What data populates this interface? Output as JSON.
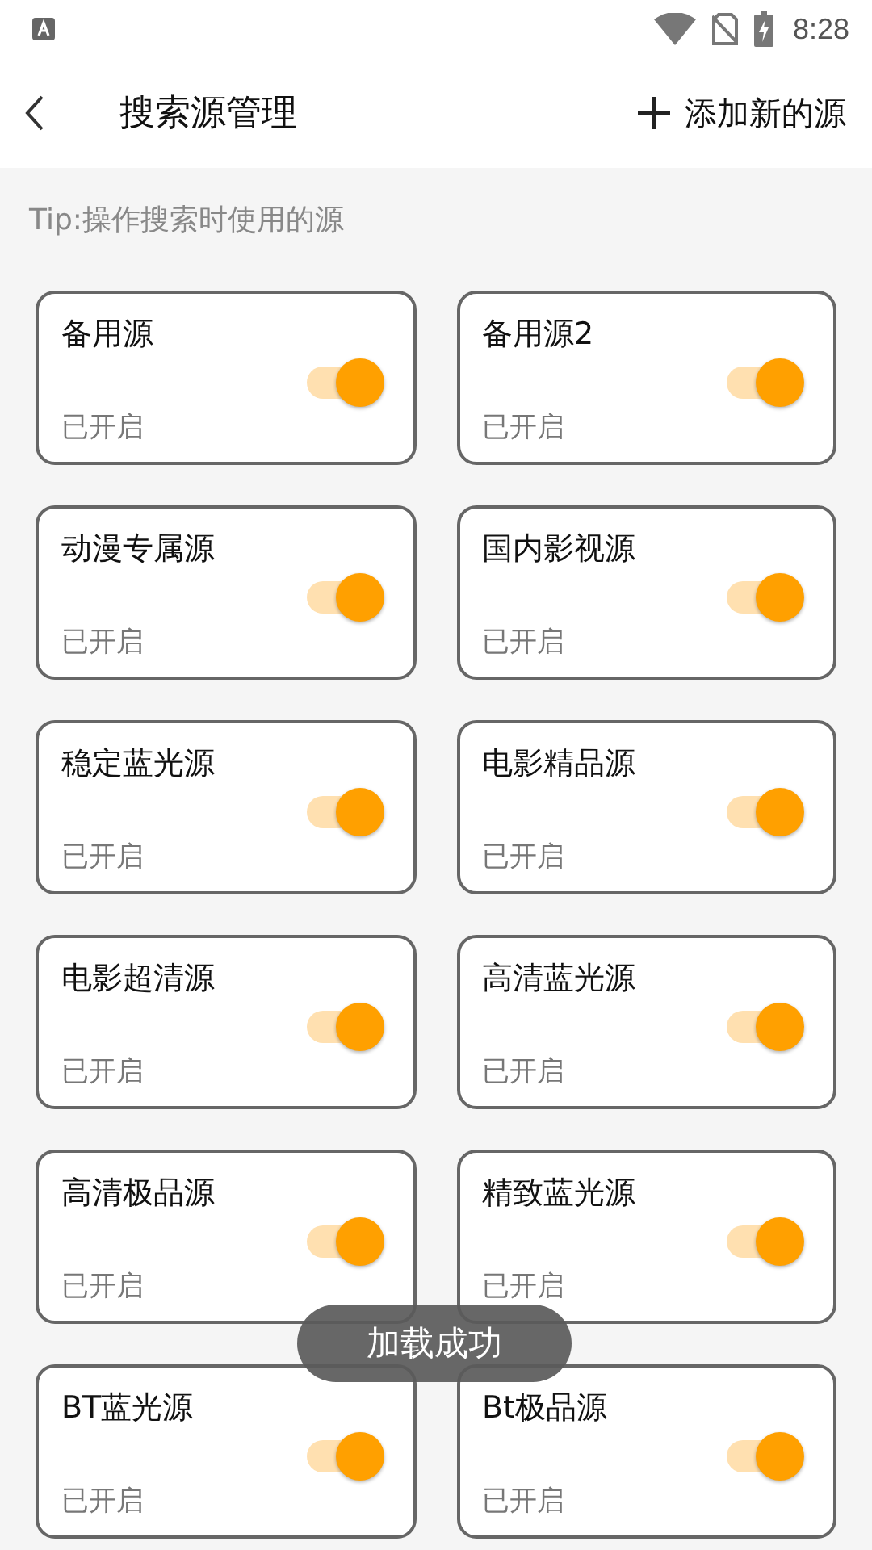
{
  "status_bar": {
    "time": "8:28"
  },
  "header": {
    "title": "搜索源管理",
    "action": "添加新的源"
  },
  "tip": "Tip:操作搜索时使用的源",
  "sources": [
    {
      "name": "备用源",
      "on": true,
      "status": "已开启"
    },
    {
      "name": "备用源2",
      "on": true,
      "status": "已开启"
    },
    {
      "name": "动漫专属源",
      "on": true,
      "status": "已开启"
    },
    {
      "name": "国内影视源",
      "on": true,
      "status": "已开启"
    },
    {
      "name": "稳定蓝光源",
      "on": true,
      "status": "已开启"
    },
    {
      "name": "电影精品源",
      "on": true,
      "status": "已开启"
    },
    {
      "name": "电影超清源",
      "on": true,
      "status": "已开启"
    },
    {
      "name": "高清蓝光源",
      "on": true,
      "status": "已开启"
    },
    {
      "name": "高清极品源",
      "on": true,
      "status": "已开启"
    },
    {
      "name": "精致蓝光源",
      "on": true,
      "status": "已开启"
    },
    {
      "name": "BT蓝光源",
      "on": true,
      "status": "已开启"
    },
    {
      "name": "Bt极品源",
      "on": true,
      "status": "已开启"
    }
  ],
  "toast": "加载成功"
}
